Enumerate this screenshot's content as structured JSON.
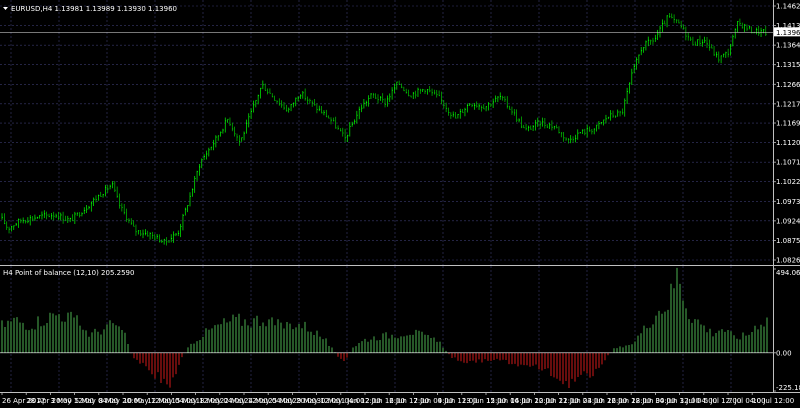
{
  "colors": {
    "background": "#000000",
    "grid": "#3a3a6e",
    "axis": "#c0c0c0",
    "bull": "#00ff00",
    "bear": "#00c800",
    "hist_pos": "#4caf50",
    "hist_neg": "#d11a1a",
    "price_line": "#c0c0c0",
    "level_line": "#5a5aa0",
    "text": "#ffffff"
  },
  "main_panel": {
    "title": "EURUSD,H4  1.13981 1.13989 1.13930 1.13960",
    "current_price_label": "1.13960",
    "current_price": 1.1396,
    "y_range": [
      1.0826,
      1.1462
    ],
    "y_ticks": [
      "1.14620",
      "1.14130",
      "1.13640",
      "1.13150",
      "1.12660",
      "1.12170",
      "1.11690",
      "1.11200",
      "1.10710",
      "1.10220",
      "1.09730",
      "1.09240",
      "1.08750",
      "1.08260"
    ],
    "arrow_icon": "triangle-down-icon"
  },
  "sub_panel": {
    "title": "H4 Point of balance (12,10) 205.2590",
    "y_ticks": [
      "494.0655",
      "0.00",
      "-225.1836"
    ],
    "y_range": [
      -225.1836,
      494.0655
    ]
  },
  "x_axis": {
    "labels": [
      "26 Apr 2017",
      "28 Apr 20:00",
      "3 May 12:00",
      "5 May 04:00",
      "8 May 20:00",
      "10 May 12:00",
      "12 May 04:00",
      "15 May 12:00",
      "18 May 04:00",
      "22 May 12:00",
      "24 May 04:00",
      "25 May 20:00",
      "29 May 12:00",
      "30 May 04:00",
      "1 Jun 12:00",
      "2 Jun 12:00",
      "6 Jun 12:00",
      "7 Jun 04:00",
      "9 Jun 12:00",
      "13 Jun 12:00",
      "15 Jun 04:00",
      "16 Jun 12:00",
      "20 Jun 12:00",
      "21 Jun 04:00",
      "23 Jun 12:00",
      "26 Jun 12:00",
      "28 Jun 04:00",
      "30 Jun 12:00",
      "3 Jul 04:00",
      "5 Jul 12:00",
      "7 Jul 04:00",
      "10 Jul 12:00"
    ]
  },
  "chart_data": [
    {
      "type": "candlestick",
      "title": "EURUSD,H4",
      "ylim": [
        1.0826,
        1.1462
      ],
      "anchors": [
        [
          0,
          1.0935
        ],
        [
          8,
          1.0905
        ],
        [
          20,
          1.0925
        ],
        [
          40,
          1.0935
        ],
        [
          55,
          1.094
        ],
        [
          70,
          1.0925
        ],
        [
          85,
          1.0955
        ],
        [
          100,
          1.099
        ],
        [
          112,
          1.1015
        ],
        [
          120,
          1.096
        ],
        [
          135,
          1.09
        ],
        [
          150,
          1.089
        ],
        [
          165,
          1.087
        ],
        [
          178,
          1.0895
        ],
        [
          190,
          1.0985
        ],
        [
          200,
          1.107
        ],
        [
          215,
          1.1125
        ],
        [
          228,
          1.118
        ],
        [
          240,
          1.112
        ],
        [
          252,
          1.12
        ],
        [
          262,
          1.1265
        ],
        [
          275,
          1.123
        ],
        [
          288,
          1.12
        ],
        [
          300,
          1.1245
        ],
        [
          315,
          1.121
        ],
        [
          330,
          1.118
        ],
        [
          345,
          1.113
        ],
        [
          360,
          1.1205
        ],
        [
          372,
          1.124
        ],
        [
          385,
          1.122
        ],
        [
          398,
          1.127
        ],
        [
          410,
          1.124
        ],
        [
          425,
          1.1255
        ],
        [
          440,
          1.123
        ],
        [
          455,
          1.118
        ],
        [
          470,
          1.122
        ],
        [
          485,
          1.121
        ],
        [
          500,
          1.1235
        ],
        [
          512,
          1.12
        ],
        [
          525,
          1.115
        ],
        [
          540,
          1.117
        ],
        [
          555,
          1.116
        ],
        [
          568,
          1.1125
        ],
        [
          580,
          1.1145
        ],
        [
          595,
          1.1155
        ],
        [
          608,
          1.1185
        ],
        [
          622,
          1.1195
        ],
        [
          632,
          1.129
        ],
        [
          642,
          1.136
        ],
        [
          655,
          1.138
        ],
        [
          668,
          1.1435
        ],
        [
          680,
          1.1415
        ],
        [
          692,
          1.137
        ],
        [
          705,
          1.1375
        ],
        [
          718,
          1.133
        ],
        [
          728,
          1.1345
        ],
        [
          738,
          1.142
        ],
        [
          752,
          1.14
        ],
        [
          765,
          1.1396
        ]
      ]
    },
    {
      "type": "bar",
      "title": "H4 Point of balance (12,10)",
      "last_value": 205.259,
      "ylim": [
        -225.1836,
        494.0655
      ],
      "anchors": [
        [
          0,
          160
        ],
        [
          15,
          200
        ],
        [
          30,
          170
        ],
        [
          45,
          210
        ],
        [
          60,
          240
        ],
        [
          75,
          200
        ],
        [
          90,
          110
        ],
        [
          105,
          150
        ],
        [
          115,
          180
        ],
        [
          125,
          100
        ],
        [
          132,
          -20
        ],
        [
          145,
          -80
        ],
        [
          160,
          -160
        ],
        [
          172,
          -200
        ],
        [
          180,
          -40
        ],
        [
          192,
          60
        ],
        [
          205,
          120
        ],
        [
          220,
          170
        ],
        [
          235,
          200
        ],
        [
          250,
          190
        ],
        [
          265,
          210
        ],
        [
          280,
          160
        ],
        [
          295,
          180
        ],
        [
          310,
          150
        ],
        [
          325,
          80
        ],
        [
          338,
          -20
        ],
        [
          345,
          -60
        ],
        [
          352,
          30
        ],
        [
          365,
          80
        ],
        [
          380,
          100
        ],
        [
          395,
          110
        ],
        [
          410,
          130
        ],
        [
          425,
          100
        ],
        [
          440,
          60
        ],
        [
          452,
          -30
        ],
        [
          470,
          -60
        ],
        [
          490,
          -40
        ],
        [
          505,
          -50
        ],
        [
          520,
          -80
        ],
        [
          535,
          -90
        ],
        [
          550,
          -110
        ],
        [
          565,
          -190
        ],
        [
          580,
          -150
        ],
        [
          595,
          -110
        ],
        [
          605,
          -40
        ],
        [
          615,
          30
        ],
        [
          630,
          40
        ],
        [
          645,
          150
        ],
        [
          655,
          240
        ],
        [
          668,
          300
        ],
        [
          678,
          494
        ],
        [
          688,
          250
        ],
        [
          700,
          180
        ],
        [
          712,
          120
        ],
        [
          722,
          150
        ],
        [
          735,
          90
        ],
        [
          748,
          110
        ],
        [
          758,
          180
        ],
        [
          768,
          205
        ]
      ]
    }
  ]
}
